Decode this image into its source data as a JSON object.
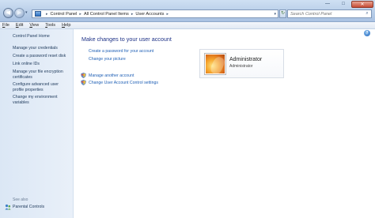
{
  "window": {
    "minimize_glyph": "—",
    "maximize_glyph": "□",
    "close_glyph": "✕"
  },
  "address": {
    "crumbs": [
      "Control Panel",
      "All Control Panel Items",
      "User Accounts"
    ],
    "separator": "▸",
    "search_placeholder": "Search Control Panel"
  },
  "menu": {
    "items": [
      {
        "key": "F",
        "rest": "ile"
      },
      {
        "key": "E",
        "rest": "dit"
      },
      {
        "key": "V",
        "rest": "iew"
      },
      {
        "key": "T",
        "rest": "ools"
      },
      {
        "key": "H",
        "rest": "elp"
      }
    ]
  },
  "sidebar": {
    "home": "Control Panel Home",
    "links": [
      "Manage your credentials",
      "Create a password reset disk",
      "Link online IDs",
      "Manage your file encryption certificates",
      "Configure advanced user profile properties",
      "Change my environment variables"
    ],
    "see_also_label": "See also",
    "see_also_links": [
      "Parental Controls"
    ]
  },
  "main": {
    "heading": "Make changes to your user account",
    "account_links": [
      "Create a password for your account",
      "Change your picture"
    ],
    "other_links": [
      "Manage another account",
      "Change User Account Control settings"
    ],
    "account": {
      "name": "Administrator",
      "role": "Administrator"
    },
    "help_glyph": "?"
  },
  "colors": {
    "link": "#1e5fb5",
    "heading": "#1e3287",
    "sidebar_bg": "#dbe7f5"
  },
  "icons": [
    "back-arrow-icon",
    "forward-arrow-icon",
    "control-panel-icon",
    "refresh-icon",
    "search-icon",
    "uac-shield-icon",
    "parental-controls-icon",
    "help-icon"
  ]
}
